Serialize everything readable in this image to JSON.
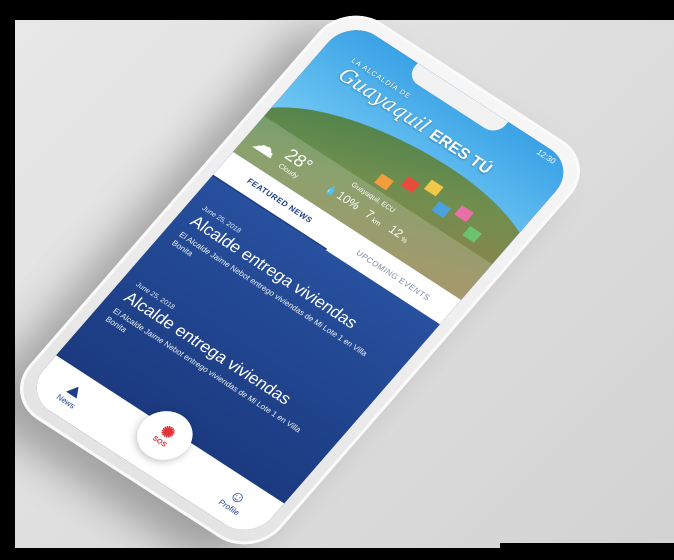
{
  "app": {
    "logo_small": "LA ALCALDÍA DE",
    "logo_script": "Guayaquil",
    "logo_bold": "ERES TÚ",
    "status_time": "12:30"
  },
  "weather": {
    "icon": "cloud-sun-icon",
    "temperature": "28°",
    "condition": "Cloudy",
    "location": "Guayaquil, ECU",
    "rain": "10%",
    "rain_icon": "droplet-icon",
    "wind": "7",
    "wind_unit": "km",
    "humidity": "12",
    "humidity_unit": "%"
  },
  "tabs": [
    {
      "label": "FEATURED NEWS",
      "active": true
    },
    {
      "label": "UPCOMING EVENTS",
      "active": false
    }
  ],
  "articles": [
    {
      "date": "June 25, 2018",
      "title": "Alcalde entrega viviendas",
      "summary": "El Alcalde Jaime Nebot entrego viviendas de Mi Lote 1 en Villa Bonita"
    },
    {
      "date": "June 25, 2018",
      "title": "Alcalde entrega viviendas",
      "summary": "El Alcalde Jaime Nebot entrego viviendas de Mi Lote 1 en Villa Bonita"
    }
  ],
  "bottom_nav": {
    "news_label": "News",
    "news_icon": "mountain-icon",
    "sos_label": "SOS",
    "sos_icon": "alert-icon",
    "profile_label": "Profile",
    "profile_icon": "user-icon"
  },
  "colors": {
    "primary": "#1d3f8a",
    "sky": "#3aa2e6",
    "sos_red": "#e0323a"
  }
}
